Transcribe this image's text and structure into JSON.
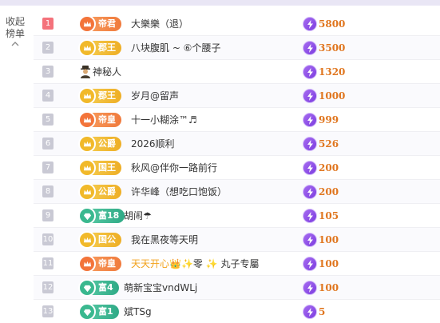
{
  "collapse": {
    "label_line1": "收起",
    "label_line2": "榜单"
  },
  "rows": [
    {
      "rank": "1",
      "badge": "帝君",
      "badge_style": "red",
      "name": "大樂樂（退）",
      "score": "5800"
    },
    {
      "rank": "2",
      "badge": "郡王",
      "badge_style": "gold",
      "name": "八块腹肌 ~ ⑥个腰子",
      "score": "3500"
    },
    {
      "rank": "3",
      "badge": "",
      "badge_style": "none",
      "name": "神秘人",
      "score": "1320"
    },
    {
      "rank": "4",
      "badge": "郡王",
      "badge_style": "gold",
      "name": "岁月@留声",
      "score": "1000"
    },
    {
      "rank": "5",
      "badge": "帝皇",
      "badge_style": "red",
      "name": "十一小糊涂™♬",
      "score": "999"
    },
    {
      "rank": "6",
      "badge": "公爵",
      "badge_style": "gold",
      "name": "2026顺利",
      "score": "526"
    },
    {
      "rank": "7",
      "badge": "国王",
      "badge_style": "gold",
      "name": "秋风@伴你一路前行",
      "score": "200"
    },
    {
      "rank": "8",
      "badge": "公爵",
      "badge_style": "gold",
      "name": "许华峰（想吃口饱饭）",
      "score": "200"
    },
    {
      "rank": "9",
      "badge": "富18",
      "badge_style": "teal",
      "name": "胡闹☂",
      "score": "105"
    },
    {
      "rank": "10",
      "badge": "国公",
      "badge_style": "gold",
      "name": "我在黑夜等天明",
      "score": "100"
    },
    {
      "rank": "11",
      "badge": "帝皇",
      "badge_style": "red",
      "name": "天天开心👑✨",
      "name_extra": "零 ✨ 丸子专屬",
      "score": "100"
    },
    {
      "rank": "12",
      "badge": "富4",
      "badge_style": "teal",
      "name": "萌新宝宝vndWLj",
      "score": "100"
    },
    {
      "rank": "13",
      "badge": "富1",
      "badge_style": "teal",
      "name": "斌TSg",
      "score": "5"
    }
  ],
  "colors": {
    "rank_first": "#f4727b",
    "score": "#e0761f",
    "bolt": "#7c3de0",
    "highlight_name": "#f2a21a"
  },
  "icons": {
    "medal_red": "crown-medal-icon",
    "medal_gold": "crown-medal-icon",
    "medal_teal": "diamond-medal-icon",
    "score": "lightning-icon",
    "mystery": "mystery-person-icon",
    "collapse": "chevron-up-icon"
  }
}
